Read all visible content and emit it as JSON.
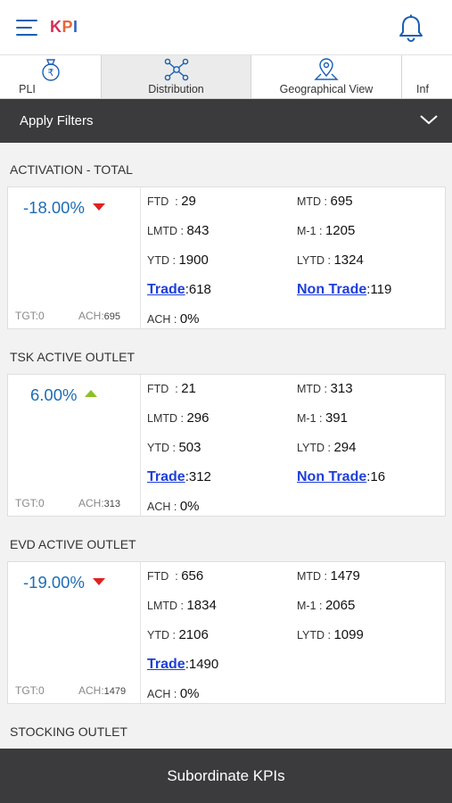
{
  "header": {
    "brand_k": "K",
    "brand_p": "P",
    "brand_i": "I"
  },
  "tabs": [
    {
      "label": "PLI",
      "icon": "money-bag-icon"
    },
    {
      "label": "Distribution",
      "icon": "network-icon",
      "active": true
    },
    {
      "label": "Geographical View",
      "icon": "map-pin-icon"
    },
    {
      "label": "Inf",
      "icon": "info-icon"
    }
  ],
  "filters": {
    "label": "Apply Filters"
  },
  "sections": [
    {
      "title": "ACTIVATION - TOTAL",
      "change": "-18.00%",
      "trend": "down",
      "tgt": "TGT:0",
      "ach_label": "ACH:",
      "ach_value": "695",
      "ftd_label": "FTD",
      "ftd_value": "29",
      "mtd_label": "MTD :",
      "mtd_value": "695",
      "lmtd_label": "LMTD :",
      "lmtd_value": "843",
      "m1_label": "M-1 :",
      "m1_value": "1205",
      "ytd_label": "YTD :",
      "ytd_value": "1900",
      "lytd_label": "LYTD :",
      "lytd_value": "1324",
      "trade_label": "Trade",
      "trade_value": ":618",
      "nontrade_label": "Non Trade",
      "nontrade_value": ":119",
      "achpct_label": "ACH :",
      "achpct_value": "0%"
    },
    {
      "title": "TSK ACTIVE OUTLET",
      "change": "6.00%",
      "trend": "up",
      "tgt": "TGT:0",
      "ach_label": "ACH:",
      "ach_value": "313",
      "ftd_label": "FTD",
      "ftd_value": "21",
      "mtd_label": "MTD :",
      "mtd_value": "313",
      "lmtd_label": "LMTD :",
      "lmtd_value": "296",
      "m1_label": "M-1 :",
      "m1_value": "391",
      "ytd_label": "YTD :",
      "ytd_value": "503",
      "lytd_label": "LYTD :",
      "lytd_value": "294",
      "trade_label": "Trade",
      "trade_value": ":312",
      "nontrade_label": "Non Trade",
      "nontrade_value": ":16",
      "achpct_label": "ACH :",
      "achpct_value": "0%"
    },
    {
      "title": "EVD ACTIVE OUTLET",
      "change": "-19.00%",
      "trend": "down",
      "tgt": "TGT:0",
      "ach_label": "ACH:",
      "ach_value": "1479",
      "ftd_label": "FTD",
      "ftd_value": "656",
      "mtd_label": "MTD :",
      "mtd_value": "1479",
      "lmtd_label": "LMTD :",
      "lmtd_value": "1834",
      "m1_label": "M-1 :",
      "m1_value": "2065",
      "ytd_label": "YTD :",
      "ytd_value": "2106",
      "lytd_label": "LYTD :",
      "lytd_value": "1099",
      "trade_label": "Trade",
      "trade_value": ":1490",
      "achpct_label": "ACH :",
      "achpct_value": "0%"
    },
    {
      "title": "STOCKING OUTLET"
    }
  ],
  "bottom": {
    "label": "Subordinate KPIs"
  },
  "colors": {
    "accent_blue": "#1d6db5",
    "bar_dark": "#3b3b3d",
    "down_red": "#e0221f",
    "up_green": "#8cbf26",
    "link_blue": "#1f3fd9"
  }
}
